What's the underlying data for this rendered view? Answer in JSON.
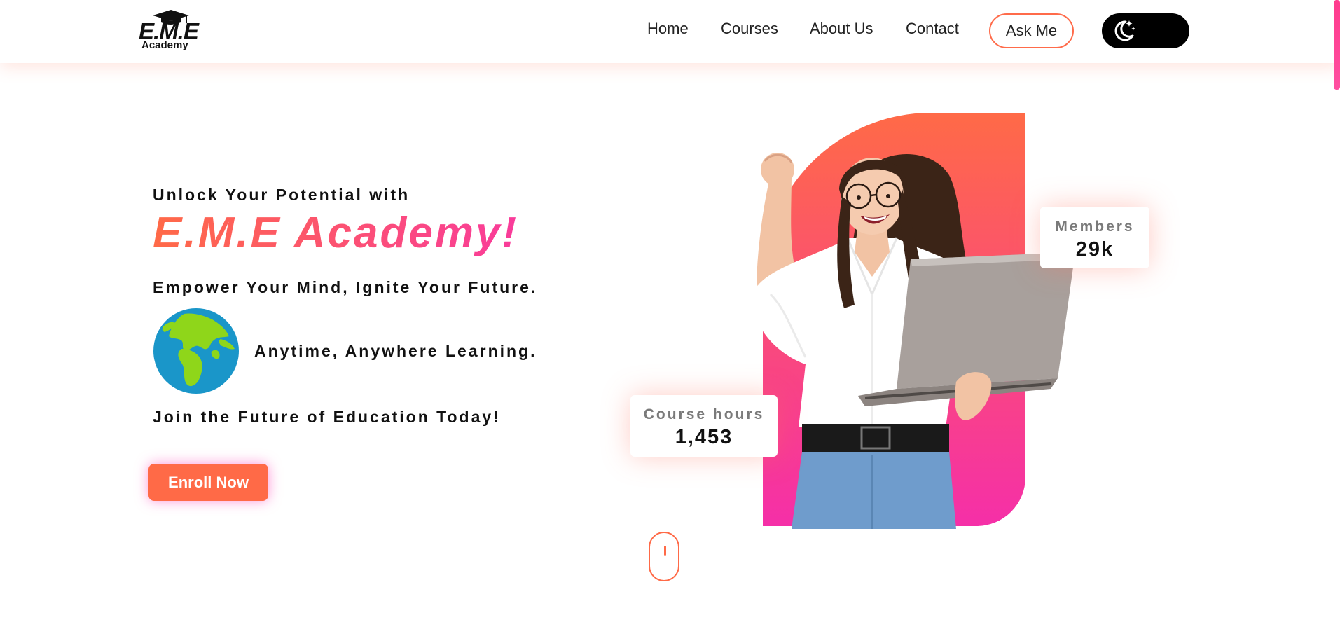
{
  "header": {
    "logo": {
      "brand": "E.M.E",
      "sub": "Academy"
    },
    "nav": [
      {
        "label": "Home"
      },
      {
        "label": "Courses"
      },
      {
        "label": "About Us"
      },
      {
        "label": "Contact"
      }
    ],
    "ask_label": "Ask Me",
    "theme_toggle_icon": "moon-stars-icon"
  },
  "hero": {
    "eyebrow": "Unlock Your Potential with",
    "headline": "E.M.E Academy!",
    "tagline": "Empower Your Mind, Ignite Your Future.",
    "anytime": "Anytime, Anywhere Learning.",
    "join": "Join the Future of Education Today!",
    "cta_label": "Enroll Now",
    "globe_icon": "globe-icon"
  },
  "stats": {
    "members": {
      "label": "Members",
      "value": "29k"
    },
    "hours": {
      "label": "Course hours",
      "value": "1,453"
    }
  },
  "colors": {
    "accent": "#ff6a47",
    "accent_pink": "#f52fa8",
    "dark": "#000000"
  }
}
